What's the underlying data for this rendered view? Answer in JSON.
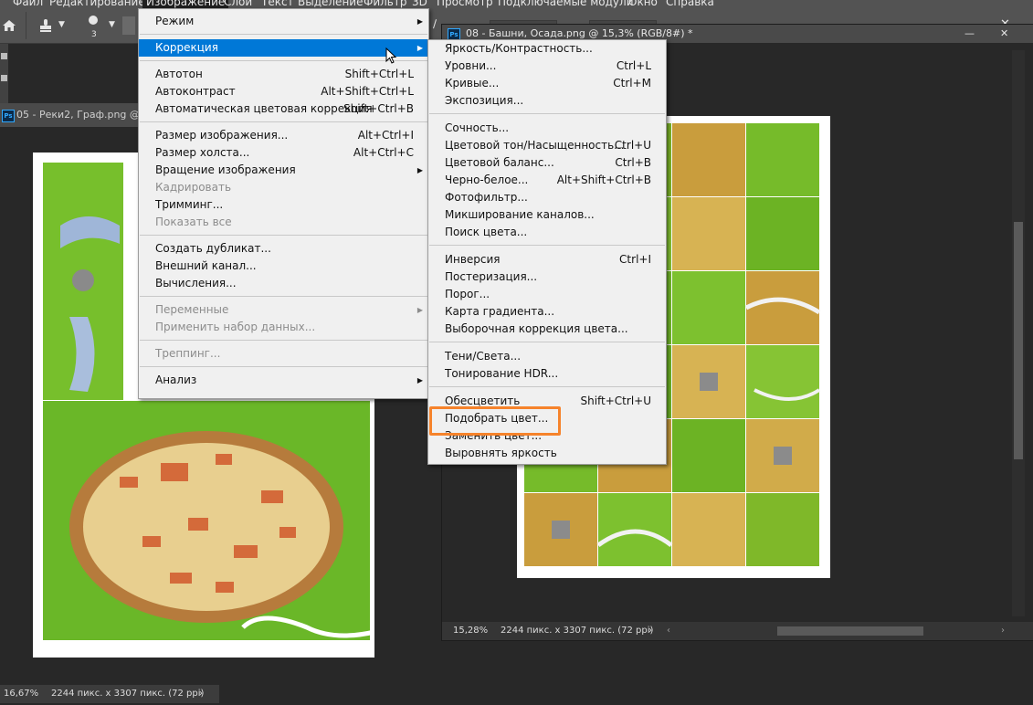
{
  "menubar": {
    "items": [
      "Файл",
      "Редактирование",
      "Изображение",
      "Слои",
      "Текст",
      "Выделение",
      "Фильтр",
      "3D",
      "Просмотр",
      "Подключаемые модули",
      "Окно",
      "Справка"
    ],
    "active": "Изображение"
  },
  "options_bar": {
    "brush_size": "3"
  },
  "documents": [
    {
      "tab_title": "05 - Реки2, Граф.png @ 1",
      "zoom": "16,67%",
      "info": "2244 пикс. x 3307 пикс. (72 ppi)"
    },
    {
      "tab_title": "08 - Башни, Осада.png @ 15,3% (RGB/8#) *",
      "zoom": "15,28%",
      "info": "2244 пикс. x 3307 пикс. (72 ppi)"
    }
  ],
  "image_menu": {
    "items": [
      {
        "label": "Режим",
        "shortcut": "",
        "submenu": true,
        "disabled": false
      },
      {
        "sep": true
      },
      {
        "label": "Коррекция",
        "shortcut": "",
        "submenu": true,
        "disabled": false,
        "selected": true
      },
      {
        "sep": true
      },
      {
        "label": "Автотон",
        "shortcut": "Shift+Ctrl+L"
      },
      {
        "label": "Автоконтраст",
        "shortcut": "Alt+Shift+Ctrl+L"
      },
      {
        "label": "Автоматическая цветовая коррекция",
        "shortcut": "Shift+Ctrl+B"
      },
      {
        "sep": true
      },
      {
        "label": "Размер изображения...",
        "shortcut": "Alt+Ctrl+I"
      },
      {
        "label": "Размер холста...",
        "shortcut": "Alt+Ctrl+C"
      },
      {
        "label": "Вращение изображения",
        "shortcut": "",
        "submenu": true
      },
      {
        "label": "Кадрировать",
        "shortcut": "",
        "disabled": true
      },
      {
        "label": "Тримминг...",
        "shortcut": ""
      },
      {
        "label": "Показать все",
        "shortcut": "",
        "disabled": true
      },
      {
        "sep": true
      },
      {
        "label": "Создать дубликат...",
        "shortcut": ""
      },
      {
        "label": "Внешний канал...",
        "shortcut": ""
      },
      {
        "label": "Вычисления...",
        "shortcut": ""
      },
      {
        "sep": true
      },
      {
        "label": "Переменные",
        "shortcut": "",
        "submenu": true,
        "disabled": true
      },
      {
        "label": "Применить набор данных...",
        "shortcut": "",
        "disabled": true
      },
      {
        "sep": true
      },
      {
        "label": "Треппинг...",
        "shortcut": "",
        "disabled": true
      },
      {
        "sep": true
      },
      {
        "label": "Анализ",
        "shortcut": "",
        "submenu": true
      }
    ]
  },
  "adjust_menu": {
    "items": [
      {
        "label": "Яркость/Контрастность...",
        "shortcut": ""
      },
      {
        "label": "Уровни...",
        "shortcut": "Ctrl+L"
      },
      {
        "label": "Кривые...",
        "shortcut": "Ctrl+M"
      },
      {
        "label": "Экспозиция...",
        "shortcut": ""
      },
      {
        "sep": true
      },
      {
        "label": "Сочность...",
        "shortcut": ""
      },
      {
        "label": "Цветовой тон/Насыщенность...",
        "shortcut": "Ctrl+U"
      },
      {
        "label": "Цветовой баланс...",
        "shortcut": "Ctrl+B"
      },
      {
        "label": "Черно-белое...",
        "shortcut": "Alt+Shift+Ctrl+B"
      },
      {
        "label": "Фотофильтр...",
        "shortcut": ""
      },
      {
        "label": "Микширование каналов...",
        "shortcut": ""
      },
      {
        "label": "Поиск цвета...",
        "shortcut": ""
      },
      {
        "sep": true
      },
      {
        "label": "Инверсия",
        "shortcut": "Ctrl+I"
      },
      {
        "label": "Постеризация...",
        "shortcut": ""
      },
      {
        "label": "Порог...",
        "shortcut": ""
      },
      {
        "label": "Карта градиента...",
        "shortcut": ""
      },
      {
        "label": "Выборочная коррекция цвета...",
        "shortcut": ""
      },
      {
        "sep": true
      },
      {
        "label": "Тени/Света...",
        "shortcut": ""
      },
      {
        "label": "Тонирование HDR...",
        "shortcut": ""
      },
      {
        "sep": true
      },
      {
        "label": "Обесцветить",
        "shortcut": "Shift+Ctrl+U"
      },
      {
        "label": "Подобрать цвет...",
        "shortcut": "",
        "highlighted": true
      },
      {
        "label": "Заменить цвет...",
        "shortcut": ""
      },
      {
        "label": "Выровнять яркость",
        "shortcut": ""
      }
    ]
  },
  "colors": {
    "accent": "#0078d7",
    "highlight_box": "#f6832b",
    "ps_blue": "#31a8ff"
  }
}
